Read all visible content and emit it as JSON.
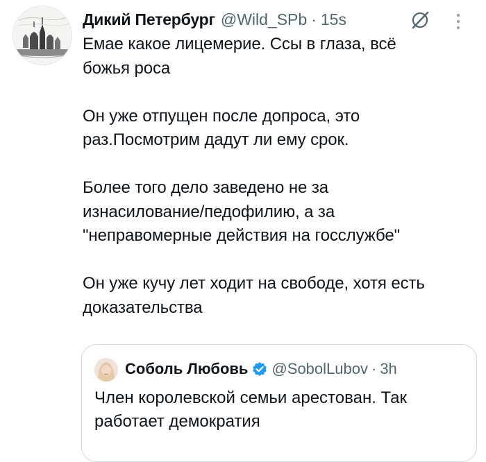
{
  "tweet": {
    "display_name": "Дикий Петербург",
    "handle": "@Wild_SPb",
    "separator": "·",
    "time": "15s",
    "avatar_icon": "city-skyline-avatar",
    "paragraphs": [
      "Емае какое лицемерие. Ссы в глаза, всё\nбожья роса",
      "Он уже отпущен после допроса, это\nраз.Посмотрим дадут ли ему срок.",
      "Более того дело заведено не за\nизнасилование/педофилию, а за\n\"неправомерные действия на госслужбе\"",
      "Он уже кучу лет ходит на свободе, хотя есть\nдоказательства"
    ]
  },
  "actions": {
    "grok_icon": "grok-slash-circle-icon",
    "more_icon": "more-vertical-icon"
  },
  "quote": {
    "display_name": "Соболь Любовь",
    "verified_icon": "verified-badge-icon",
    "handle": "@SobolLubov",
    "separator": "·",
    "time": "3h",
    "text": "Член королевской семьи арестован. Так\nработает демократия"
  },
  "colors": {
    "text_primary": "#0f1419",
    "text_secondary": "#536471",
    "border": "#cfd9de",
    "verified": "#1d9bf0"
  }
}
